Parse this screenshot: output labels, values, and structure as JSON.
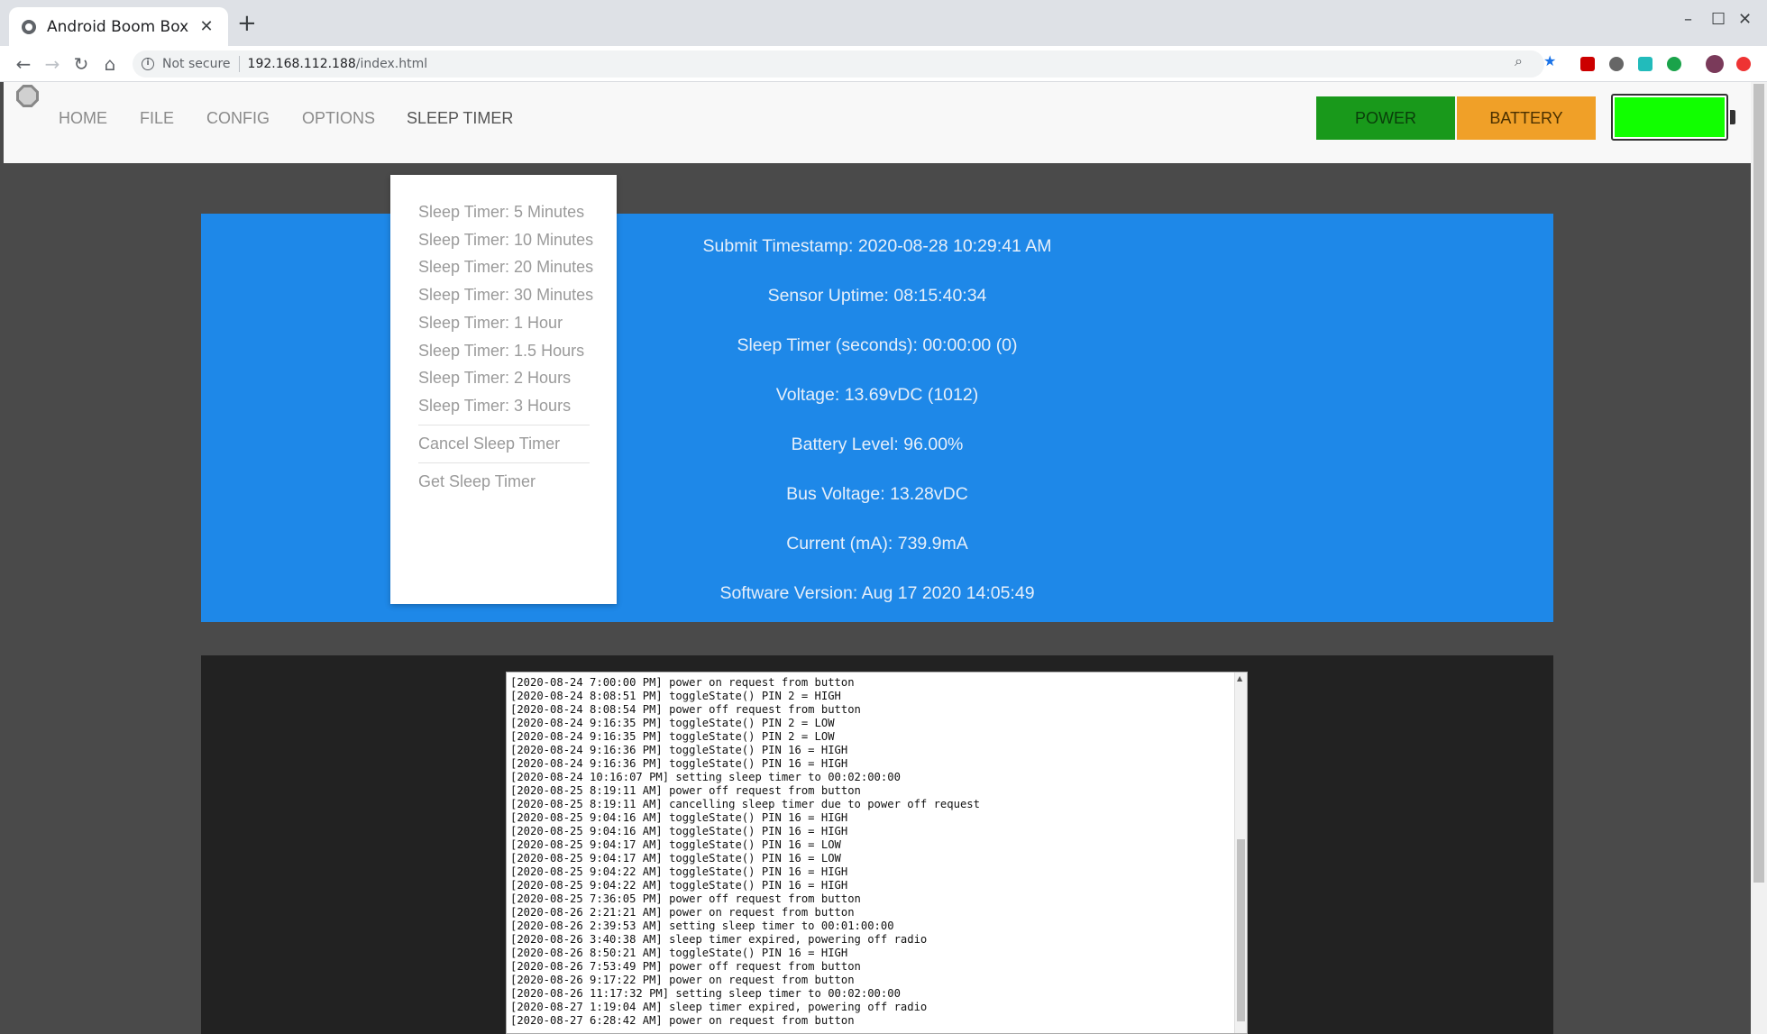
{
  "browser": {
    "tab_title": "Android Boom Box",
    "tab_close": "✕",
    "new_tab": "+",
    "security_label": "Not secure",
    "url_host": "192.168.112.188",
    "url_path": "/index.html",
    "window_controls": [
      "–",
      "☐",
      "✕"
    ]
  },
  "nav": {
    "items": [
      "HOME",
      "FILE",
      "CONFIG",
      "OPTIONS",
      "SLEEP TIMER"
    ],
    "active": "SLEEP TIMER",
    "power_label": "POWER",
    "battery_label": "BATTERY",
    "battery_gauge_level": 1.0,
    "colors": {
      "power": "#19991b",
      "battery": "#f0a028",
      "gauge": "#11ff00",
      "panel": "#1e88e8"
    }
  },
  "sleep_menu": {
    "items": [
      "Sleep Timer: 5 Minutes",
      "Sleep Timer: 10 Minutes",
      "Sleep Timer: 20 Minutes",
      "Sleep Timer: 30 Minutes",
      "Sleep Timer: 1 Hour",
      "Sleep Timer: 1.5 Hours",
      "Sleep Timer: 2 Hours",
      "Sleep Timer: 3 Hours"
    ],
    "cancel": "Cancel Sleep Timer",
    "get": "Get Sleep Timer"
  },
  "status": {
    "lines": [
      "Submit Timestamp: 2020-08-28 10:29:41 AM",
      "Sensor Uptime: 08:15:40:34",
      "Sleep Timer (seconds): 00:00:00 (0)",
      "Voltage: 13.69vDC (1012)",
      "Battery Level: 96.00%",
      "Bus Voltage: 13.28vDC",
      "Current (mA): 739.9mA",
      "Software Version: Aug 17 2020 14:05:49"
    ]
  },
  "log": {
    "lines": [
      "[2020-08-24 7:00:00 PM] power on request from button",
      "[2020-08-24 8:08:51 PM] toggleState() PIN 2 = HIGH",
      "[2020-08-24 8:08:54 PM] power off request from button",
      "[2020-08-24 9:16:35 PM] toggleState() PIN 2 = LOW",
      "[2020-08-24 9:16:35 PM] toggleState() PIN 2 = LOW",
      "[2020-08-24 9:16:36 PM] toggleState() PIN 16 = HIGH",
      "[2020-08-24 9:16:36 PM] toggleState() PIN 16 = HIGH",
      "[2020-08-24 10:16:07 PM] setting sleep timer to 00:02:00:00",
      "[2020-08-25 8:19:11 AM] power off request from button",
      "[2020-08-25 8:19:11 AM] cancelling sleep timer due to power off request",
      "[2020-08-25 9:04:16 AM] toggleState() PIN 16 = HIGH",
      "[2020-08-25 9:04:16 AM] toggleState() PIN 16 = HIGH",
      "[2020-08-25 9:04:17 AM] toggleState() PIN 16 = LOW",
      "[2020-08-25 9:04:17 AM] toggleState() PIN 16 = LOW",
      "[2020-08-25 9:04:22 AM] toggleState() PIN 16 = HIGH",
      "[2020-08-25 9:04:22 AM] toggleState() PIN 16 = HIGH",
      "[2020-08-25 7:36:05 PM] power off request from button",
      "[2020-08-26 2:21:21 AM] power on request from button",
      "[2020-08-26 2:39:53 AM] setting sleep timer to 00:01:00:00",
      "[2020-08-26 3:40:38 AM] sleep timer expired, powering off radio",
      "[2020-08-26 8:50:21 AM] toggleState() PIN 16 = HIGH",
      "[2020-08-26 7:53:49 PM] power off request from button",
      "[2020-08-26 9:17:22 PM] power on request from button",
      "[2020-08-26 11:17:32 PM] setting sleep timer to 00:02:00:00",
      "[2020-08-27 1:19:04 AM] sleep timer expired, powering off radio",
      "[2020-08-27 6:28:42 AM] power on request from button"
    ]
  }
}
